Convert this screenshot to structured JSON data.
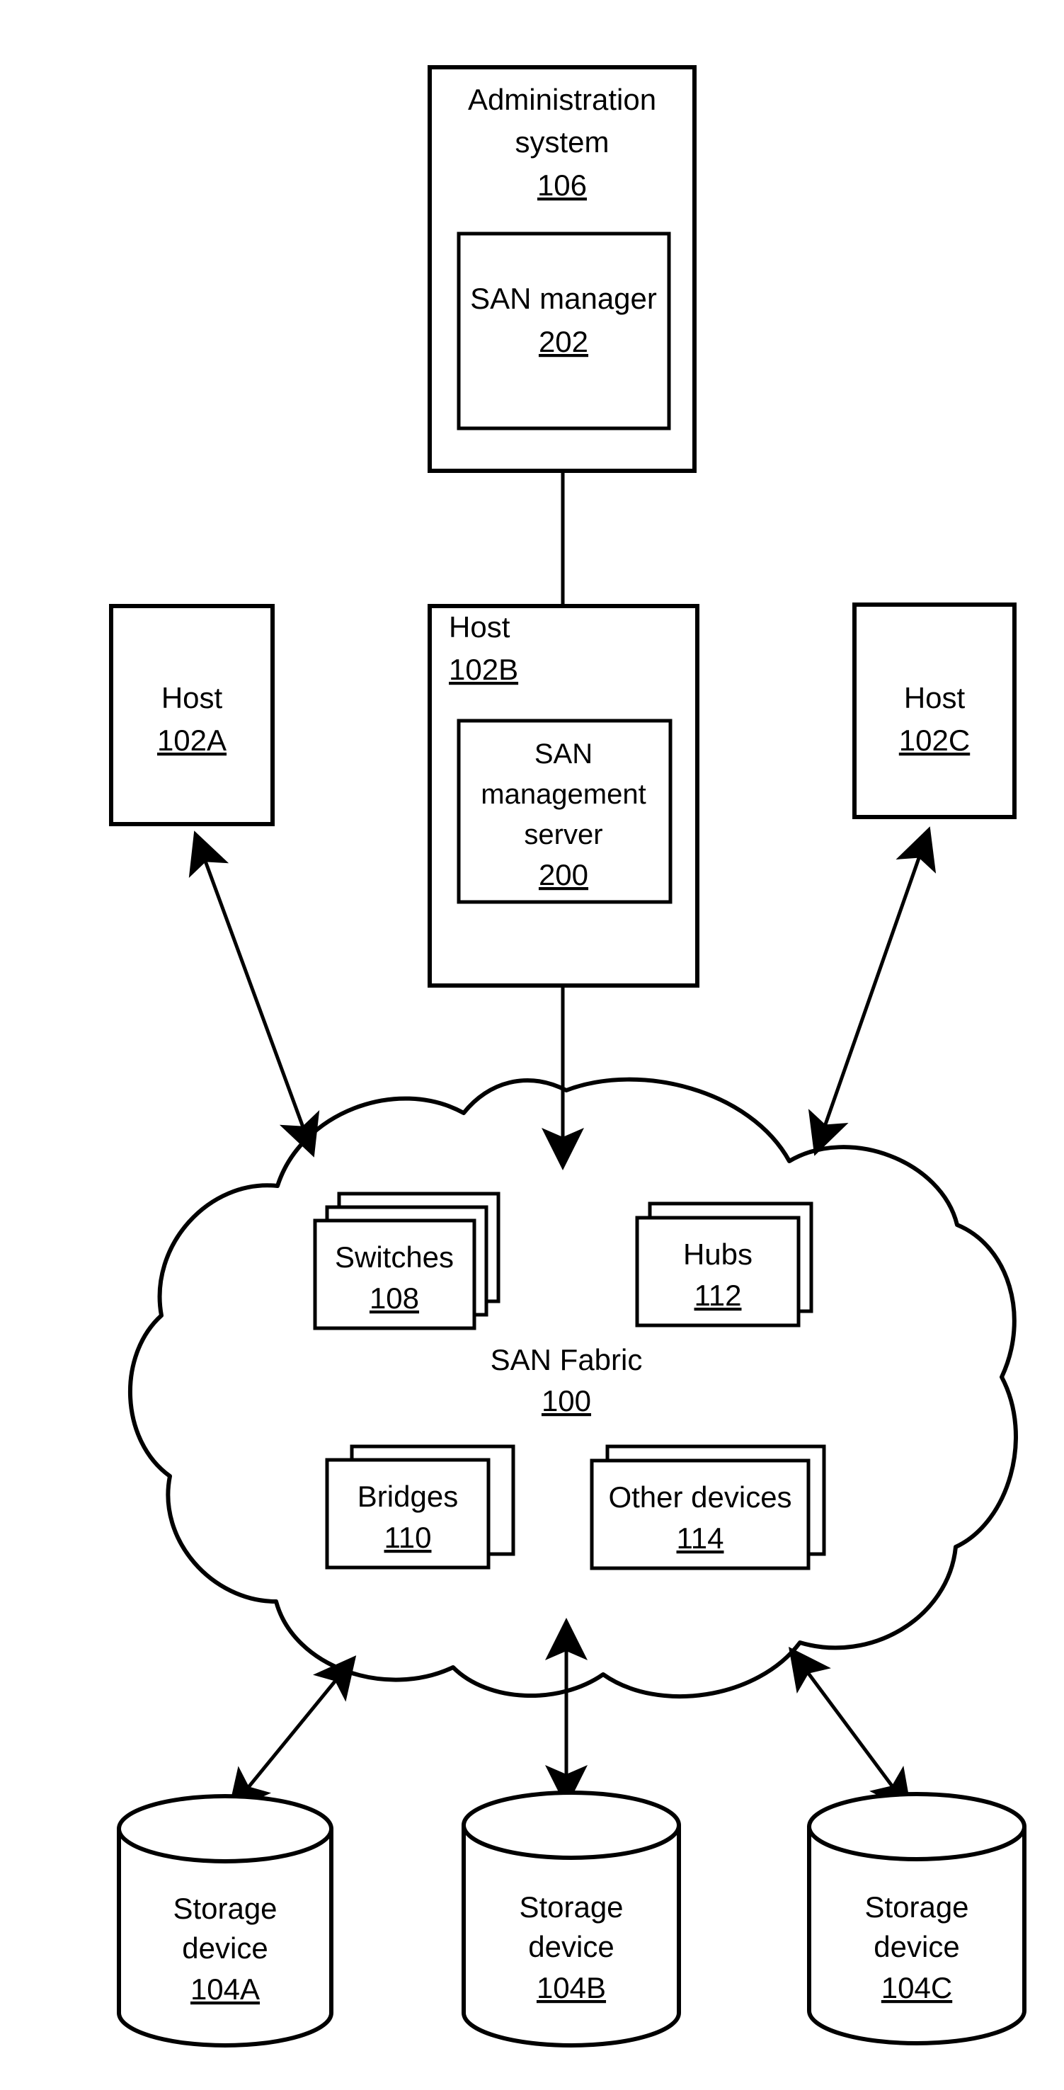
{
  "figure": {
    "title": "SAN Fabric system block diagram",
    "background_color": "#ffffff",
    "line_color": "#000000"
  },
  "nodes": {
    "administration_system": {
      "label_line1": "Administration",
      "label_line2": "system",
      "ref": "106"
    },
    "san_manager": {
      "label_line1": "SAN manager",
      "ref": "202"
    },
    "host_a": {
      "label_line1": "Host",
      "ref": "102A"
    },
    "host_b": {
      "label_line1": "Host",
      "ref": "102B"
    },
    "host_c": {
      "label_line1": "Host",
      "ref": "102C"
    },
    "san_management_server": {
      "label_line1": "SAN",
      "label_line2": "management",
      "label_line3": "server",
      "ref": "200"
    },
    "san_fabric": {
      "label_line1": "SAN Fabric",
      "ref": "100"
    },
    "switches": {
      "label_line1": "Switches",
      "ref": "108",
      "stack_layers": 3
    },
    "hubs": {
      "label_line1": "Hubs",
      "ref": "112",
      "stack_layers": 2
    },
    "bridges": {
      "label_line1": "Bridges",
      "ref": "110",
      "stack_layers": 2
    },
    "other_devices": {
      "label_line1": "Other devices",
      "ref": "114",
      "stack_layers": 2
    },
    "storage_a": {
      "label_line1": "Storage",
      "label_line2": "device",
      "ref": "104A"
    },
    "storage_b": {
      "label_line1": "Storage",
      "label_line2": "device",
      "ref": "104B"
    },
    "storage_c": {
      "label_line1": "Storage",
      "label_line2": "device",
      "ref": "104C"
    }
  },
  "connections": [
    {
      "name": "san-manager-to-san-management-server",
      "from": "san_manager",
      "to": "san_management_server",
      "arrowheads": "both"
    },
    {
      "name": "host-a-to-san-fabric",
      "from": "host_a",
      "to": "san_fabric",
      "arrowheads": "both"
    },
    {
      "name": "host-b-to-san-fabric",
      "from": "san_management_server",
      "to": "san_fabric",
      "arrowheads": "both"
    },
    {
      "name": "host-c-to-san-fabric",
      "from": "host_c",
      "to": "san_fabric",
      "arrowheads": "both"
    },
    {
      "name": "san-fabric-to-storage-a",
      "from": "san_fabric",
      "to": "storage_a",
      "arrowheads": "both"
    },
    {
      "name": "san-fabric-to-storage-b",
      "from": "san_fabric",
      "to": "storage_b",
      "arrowheads": "both"
    },
    {
      "name": "san-fabric-to-storage-c",
      "from": "san_fabric",
      "to": "storage_c",
      "arrowheads": "both"
    }
  ]
}
